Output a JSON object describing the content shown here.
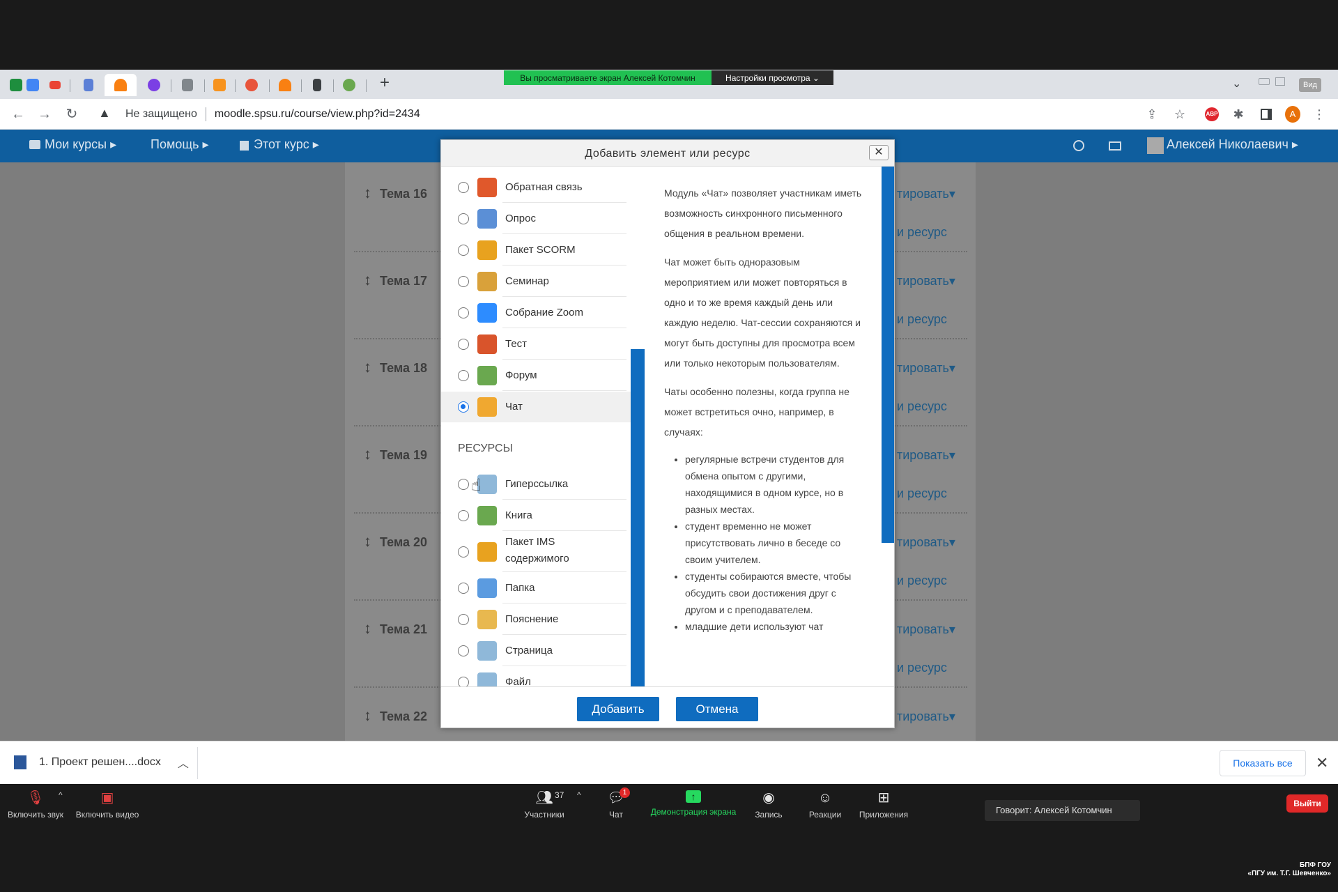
{
  "browser": {
    "share_banner": "Вы просматриваете экран Алексей Котомчин",
    "view_settings": "Настройки просмотра ⌄",
    "insecure_label": "Не защищено",
    "url": "moodle.spsu.ru/course/view.php?id=2434",
    "new_tab": "+",
    "view_btn": "Вид"
  },
  "moodle_nav": {
    "my_courses": "Мои курсы ▸",
    "help": "Помощь ▸",
    "this_course": "Этот курс ▸",
    "user": "Алексей Николаевич ▸"
  },
  "course": {
    "topics": [
      "Тема 16",
      "Тема 17",
      "Тема 18",
      "Тема 19",
      "Тема 20",
      "Тема 21",
      "Тема 22"
    ],
    "edit_label": "тировать▾",
    "resource_label": "и ресурс"
  },
  "dialog": {
    "title": "Добавить элемент или ресурс",
    "close": "✕",
    "activities": [
      {
        "label": "Обратная связь",
        "icon": "megaphone-icon",
        "color": "#e0582b"
      },
      {
        "label": "Опрос",
        "icon": "question-icon",
        "color": "#5b8fd6"
      },
      {
        "label": "Пакет SCORM",
        "icon": "package-icon",
        "color": "#e8a21f"
      },
      {
        "label": "Семинар",
        "icon": "users-icon",
        "color": "#d9a13a"
      },
      {
        "label": "Собрание Zoom",
        "icon": "zoom-icon",
        "color": "#2d8cff"
      },
      {
        "label": "Тест",
        "icon": "checklist-icon",
        "color": "#d9542b"
      },
      {
        "label": "Форум",
        "icon": "forum-icon",
        "color": "#6aa84f"
      },
      {
        "label": "Чат",
        "icon": "chat-icon",
        "color": "#f0a830"
      }
    ],
    "resources_header": "РЕСУРСЫ",
    "resources": [
      {
        "label": "Гиперссылка",
        "icon": "link-icon",
        "color": "#8fb8d9"
      },
      {
        "label": "Книга",
        "icon": "book-icon",
        "color": "#6aa84f"
      },
      {
        "label": "Пакет IMS",
        "label2": "содержимого",
        "icon": "ims-icon",
        "color": "#e8a21f"
      },
      {
        "label": "Папка",
        "icon": "folder-icon",
        "color": "#5b9be0"
      },
      {
        "label": "Пояснение",
        "icon": "label-icon",
        "color": "#e8b84f"
      },
      {
        "label": "Страница",
        "icon": "page-icon",
        "color": "#8fb8d9"
      },
      {
        "label": "Файл",
        "icon": "file-icon",
        "color": "#8fb8d9"
      }
    ],
    "help": {
      "p1": "Модуль «Чат» позволяет участникам иметь возможность синхронного письменного общения в реальном времени.",
      "p2": "Чат может быть одноразовым мероприятием или может повторяться в одно и то же время каждый день или каждую неделю. Чат-сессии сохраняются и могут быть доступны для просмотра всем или только некоторым пользователям.",
      "p3": "Чаты особенно полезны, когда группа не может встретиться очно, например, в случаях:",
      "bullets": [
        "регулярные встречи студентов для обмена опытом с другими, находящимися в одном курсе, но в разных местах.",
        "студент временно не может присутствовать лично в беседе со своим учителем.",
        "студенты собираются вместе, чтобы обсудить свои достижения друг с другом и с преподавателем.",
        "младшие дети используют чат"
      ]
    },
    "add_button": "Добавить",
    "cancel_button": "Отмена"
  },
  "downloads": {
    "file": "1. Проект решен....docx",
    "show_all": "Показать все",
    "close": "✕"
  },
  "zoom": {
    "audio": "Включить звук",
    "video": "Включить видео",
    "participants": "Участники",
    "participants_count": "37",
    "chat": "Чат",
    "chat_badge": "1",
    "share": "Демонстрация экрана",
    "record": "Запись",
    "reactions": "Реакции",
    "apps": "Приложения",
    "speaker": "Говорит: Алексей Котомчин",
    "leave": "Выйти"
  },
  "watermark": {
    "line1": "БПФ ГОУ",
    "line2": "«ПГУ им. Т.Г. Шевченко»"
  }
}
